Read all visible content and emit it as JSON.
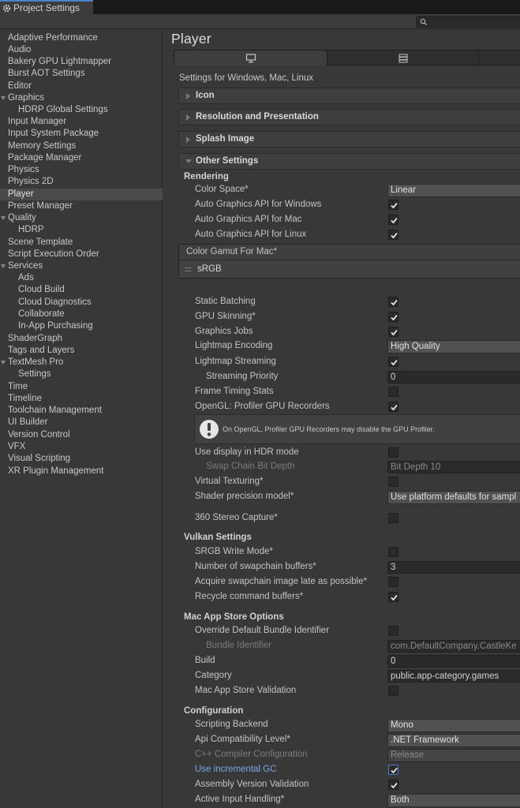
{
  "window": {
    "title": "Project Settings",
    "search_placeholder": ""
  },
  "sidebar": {
    "items": [
      {
        "label": "Adaptive Performance",
        "level": 0
      },
      {
        "label": "Audio",
        "level": 0
      },
      {
        "label": "Bakery GPU Lightmapper",
        "level": 0
      },
      {
        "label": "Burst AOT Settings",
        "level": 0
      },
      {
        "label": "Editor",
        "level": 0
      },
      {
        "label": "Graphics",
        "level": 0,
        "expanded": true
      },
      {
        "label": "HDRP Global Settings",
        "level": 1
      },
      {
        "label": "Input Manager",
        "level": 0
      },
      {
        "label": "Input System Package",
        "level": 0
      },
      {
        "label": "Memory Settings",
        "level": 0
      },
      {
        "label": "Package Manager",
        "level": 0
      },
      {
        "label": "Physics",
        "level": 0
      },
      {
        "label": "Physics 2D",
        "level": 0
      },
      {
        "label": "Player",
        "level": 0,
        "selected": true
      },
      {
        "label": "Preset Manager",
        "level": 0
      },
      {
        "label": "Quality",
        "level": 0,
        "expanded": true
      },
      {
        "label": "HDRP",
        "level": 1
      },
      {
        "label": "Scene Template",
        "level": 0
      },
      {
        "label": "Script Execution Order",
        "level": 0
      },
      {
        "label": "Services",
        "level": 0,
        "expanded": true
      },
      {
        "label": "Ads",
        "level": 1
      },
      {
        "label": "Cloud Build",
        "level": 1
      },
      {
        "label": "Cloud Diagnostics",
        "level": 1
      },
      {
        "label": "Collaborate",
        "level": 1
      },
      {
        "label": "In-App Purchasing",
        "level": 1
      },
      {
        "label": "ShaderGraph",
        "level": 0
      },
      {
        "label": "Tags and Layers",
        "level": 0
      },
      {
        "label": "TextMesh Pro",
        "level": 0,
        "expanded": true
      },
      {
        "label": "Settings",
        "level": 1
      },
      {
        "label": "Time",
        "level": 0
      },
      {
        "label": "Timeline",
        "level": 0
      },
      {
        "label": "Toolchain Management",
        "level": 0
      },
      {
        "label": "UI Builder",
        "level": 0
      },
      {
        "label": "Version Control",
        "level": 0
      },
      {
        "label": "VFX",
        "level": 0
      },
      {
        "label": "Visual Scripting",
        "level": 0
      },
      {
        "label": "XR Plugin Management",
        "level": 0
      }
    ]
  },
  "main": {
    "title": "Player",
    "platform_tabs": [
      {
        "icon": "monitor-icon",
        "active": true
      },
      {
        "icon": "server-icon",
        "active": false
      },
      {
        "icon": "",
        "active": false
      }
    ],
    "platform_label": "Settings for Windows, Mac, Linux",
    "foldouts": {
      "icon": "Icon",
      "resolution": "Resolution and Presentation",
      "splash": "Splash Image",
      "other": "Other Settings"
    },
    "rendering": {
      "heading": "Rendering",
      "color_space": {
        "label": "Color Space*",
        "value": "Linear"
      },
      "auto_api_windows": {
        "label": "Auto Graphics API  for Windows",
        "checked": true
      },
      "auto_api_mac": {
        "label": "Auto Graphics API  for Mac",
        "checked": true
      },
      "auto_api_linux": {
        "label": "Auto Graphics API  for Linux",
        "checked": true
      },
      "color_gamut": {
        "header": "Color Gamut For Mac*",
        "items": [
          "sRGB"
        ]
      },
      "static_batching": {
        "label": "Static Batching",
        "checked": true
      },
      "gpu_skinning": {
        "label": "GPU Skinning*",
        "checked": true
      },
      "graphics_jobs": {
        "label": "Graphics Jobs",
        "checked": true
      },
      "lightmap_encoding": {
        "label": "Lightmap Encoding",
        "value": "High Quality"
      },
      "lightmap_streaming": {
        "label": "Lightmap Streaming",
        "checked": true
      },
      "streaming_priority": {
        "label": "Streaming Priority",
        "value": "0"
      },
      "frame_timing": {
        "label": "Frame Timing Stats",
        "checked": false
      },
      "opengl_recorders": {
        "label": "OpenGL: Profiler GPU Recorders",
        "checked": true
      },
      "help_text": "On OpenGL, Profiler GPU Recorders may disable the GPU Profiler.",
      "hdr_display": {
        "label": "Use display in HDR mode",
        "checked": false
      },
      "swap_chain_depth": {
        "label": "Swap Chain Bit Depth",
        "value": "Bit Depth 10"
      },
      "virtual_texturing": {
        "label": "Virtual Texturing*",
        "checked": false
      },
      "shader_precision": {
        "label": "Shader precision model*",
        "value": "Use platform defaults for sampl"
      },
      "stereo_capture": {
        "label": "360 Stereo Capture*",
        "checked": false
      }
    },
    "vulkan": {
      "heading": "Vulkan Settings",
      "srgb_write": {
        "label": "SRGB Write Mode*",
        "checked": false
      },
      "swapchain_buffers": {
        "label": "Number of swapchain buffers*",
        "value": "3"
      },
      "acquire_late": {
        "label": "Acquire swapchain image late as possible*",
        "checked": false
      },
      "recycle_buffers": {
        "label": "Recycle command buffers*",
        "checked": true
      }
    },
    "mac_store": {
      "heading": "Mac App Store Options",
      "override_bundle": {
        "label": "Override Default Bundle Identifier",
        "checked": false
      },
      "bundle_id": {
        "label": "Bundle Identifier",
        "value": "com.DefaultCompany.CastleKe"
      },
      "build": {
        "label": "Build",
        "value": "0"
      },
      "category": {
        "label": "Category",
        "value": "public.app-category.games"
      },
      "validation": {
        "label": "Mac App Store Validation",
        "checked": false
      }
    },
    "configuration": {
      "heading": "Configuration",
      "scripting_backend": {
        "label": "Scripting Backend",
        "value": "Mono"
      },
      "api_level": {
        "label": "Api Compatibility Level*",
        "value": ".NET Framework"
      },
      "cpp_config": {
        "label": "C++ Compiler Configuration",
        "value": "Release"
      },
      "incremental_gc": {
        "label": "Use incremental GC",
        "checked": true
      },
      "assembly_validation": {
        "label": "Assembly Version Validation",
        "checked": true
      },
      "input_handling": {
        "label": "Active Input Handling*",
        "value": "Both"
      }
    }
  },
  "colors": {
    "panel_bg": "#383838",
    "field_bg": "#2a2a2a",
    "selection": "#4a4a4a",
    "accent": "#4b82d0",
    "link_text": "#7aa7e8"
  }
}
